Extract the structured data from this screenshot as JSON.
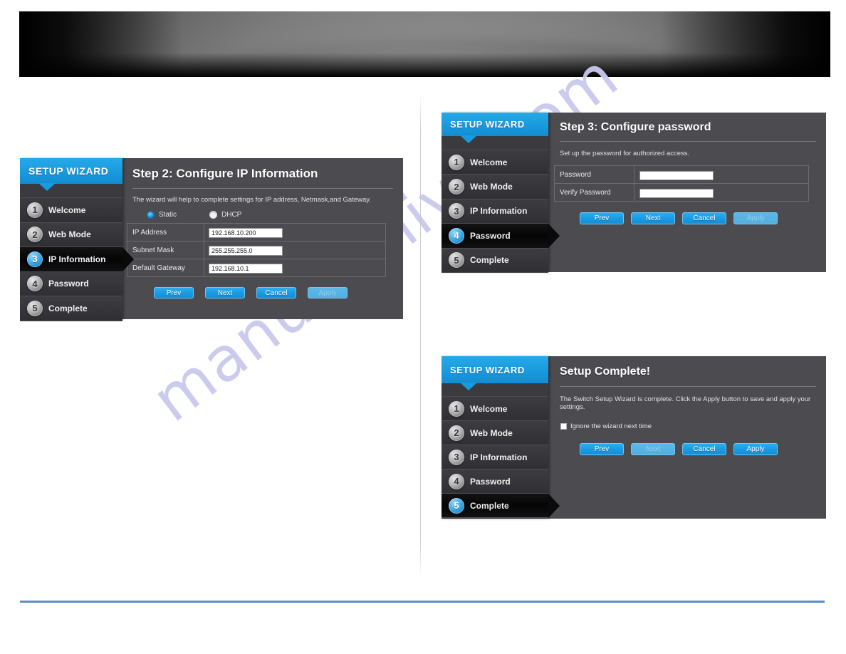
{
  "banner": {
    "name": "decorative-header-banner",
    "background_color": "#050505",
    "accent_color": "#8c8c8c"
  },
  "watermark": {
    "text": "manualshive.com",
    "color": "#c9c9ee"
  },
  "colors": {
    "brand_blue": "#1d9ae2",
    "sidebar_dark": "#2f2f33",
    "content_gray": "#4b4b50",
    "rule_blue": "#5b8cc8"
  },
  "wizards": [
    {
      "id": "wizard-ip",
      "sidebar": {
        "title": "SETUP WIZARD",
        "steps": [
          {
            "num": "1",
            "label": "Welcome",
            "active": false
          },
          {
            "num": "2",
            "label": "Web Mode",
            "active": false
          },
          {
            "num": "3",
            "label": "IP Information",
            "active": true
          },
          {
            "num": "4",
            "label": "Password",
            "active": false
          },
          {
            "num": "5",
            "label": "Complete",
            "active": false
          }
        ]
      },
      "content": {
        "title": "Step 2: Configure IP Information",
        "description": "The wizard will help to complete settings for IP address, Netmask,and Gateway.",
        "radios": [
          {
            "label": "Static",
            "selected": true
          },
          {
            "label": "DHCP",
            "selected": false
          }
        ],
        "fields": [
          {
            "label": "IP Address",
            "value": "192.168.10.200",
            "placeholder": ""
          },
          {
            "label": "Subnet Mask",
            "value": "255.255.255.0",
            "placeholder": ""
          },
          {
            "label": "Default Gateway",
            "value": "192.168.10.1",
            "placeholder": ""
          }
        ],
        "buttons": [
          {
            "label": "Prev",
            "disabled": false
          },
          {
            "label": "Next",
            "disabled": false
          },
          {
            "label": "Cancel",
            "disabled": false
          },
          {
            "label": "Apply",
            "disabled": true
          }
        ]
      }
    },
    {
      "id": "wizard-password",
      "sidebar": {
        "title": "SETUP WIZARD",
        "steps": [
          {
            "num": "1",
            "label": "Welcome",
            "active": false
          },
          {
            "num": "2",
            "label": "Web Mode",
            "active": false
          },
          {
            "num": "3",
            "label": "IP Information",
            "active": false
          },
          {
            "num": "4",
            "label": "Password",
            "active": true
          },
          {
            "num": "5",
            "label": "Complete",
            "active": false
          }
        ]
      },
      "content": {
        "title": "Step 3: Configure password",
        "description": "Set up the password for authorized access.",
        "fields": [
          {
            "label": "Password",
            "value": "",
            "placeholder": ""
          },
          {
            "label": "Verify Password",
            "value": "",
            "placeholder": ""
          }
        ],
        "buttons": [
          {
            "label": "Prev",
            "disabled": false
          },
          {
            "label": "Next",
            "disabled": false
          },
          {
            "label": "Cancel",
            "disabled": false
          },
          {
            "label": "Apply",
            "disabled": true
          }
        ]
      }
    },
    {
      "id": "wizard-complete",
      "sidebar": {
        "title": "SETUP WIZARD",
        "steps": [
          {
            "num": "1",
            "label": "Welcome",
            "active": false
          },
          {
            "num": "2",
            "label": "Web Mode",
            "active": false
          },
          {
            "num": "3",
            "label": "IP Information",
            "active": false
          },
          {
            "num": "4",
            "label": "Password",
            "active": false
          },
          {
            "num": "5",
            "label": "Complete",
            "active": true
          }
        ]
      },
      "content": {
        "title": "Setup Complete!",
        "description": "The Switch Setup Wizard is complete. Click the Apply button to save and apply your settings.",
        "checkbox": {
          "label": "Ignore the wizard next time",
          "checked": false
        },
        "buttons": [
          {
            "label": "Prev",
            "disabled": false
          },
          {
            "label": "Next",
            "disabled": true
          },
          {
            "label": "Cancel",
            "disabled": false
          },
          {
            "label": "Apply",
            "disabled": false
          }
        ]
      }
    }
  ]
}
